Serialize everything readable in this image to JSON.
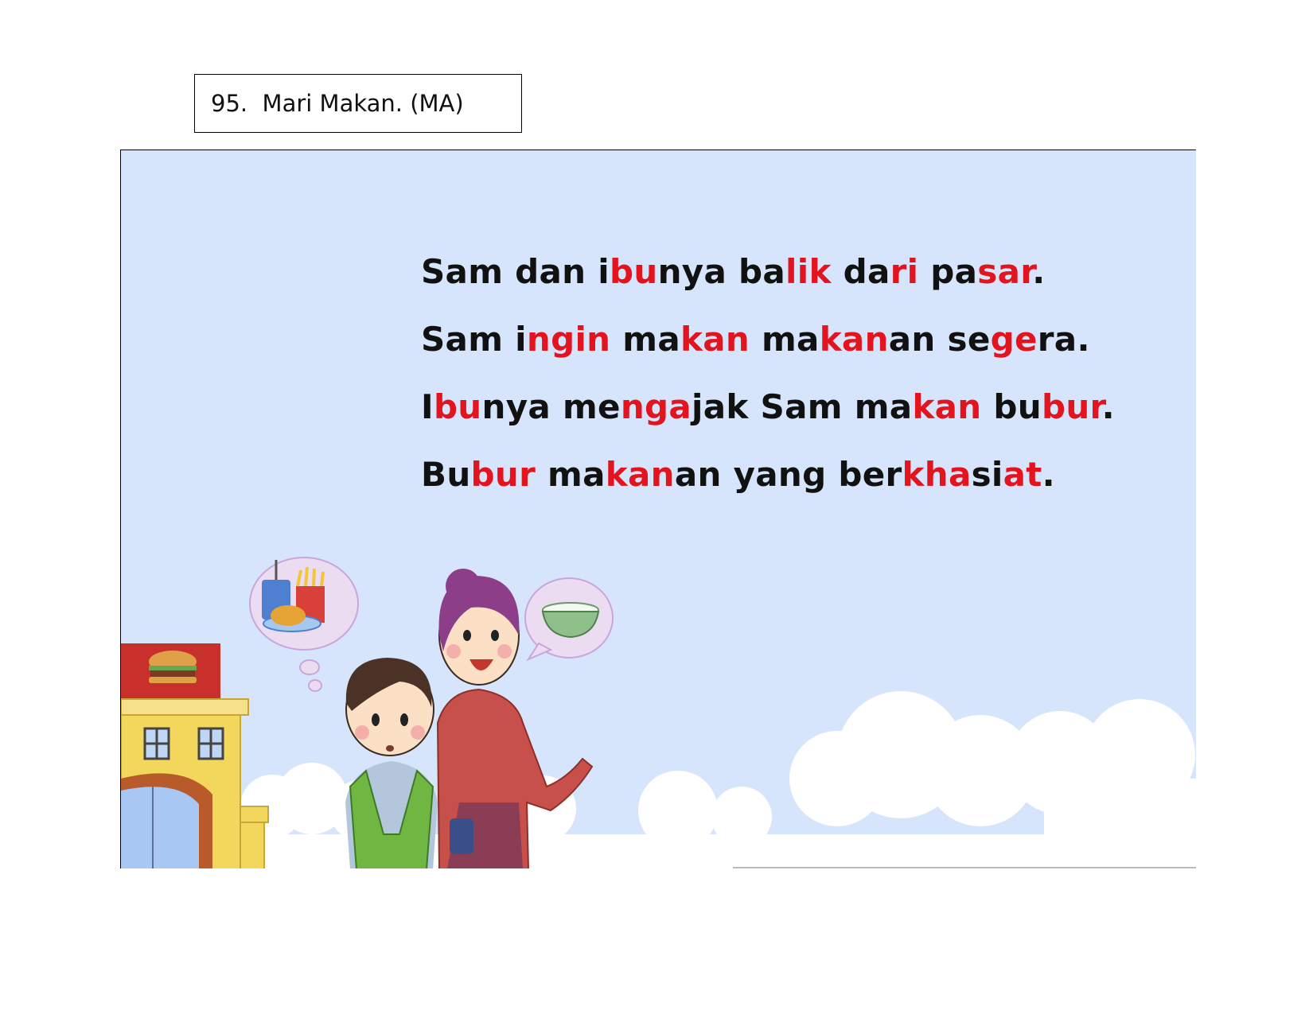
{
  "header": {
    "title": "95.  Mari Makan. (MA)"
  },
  "story": {
    "lines": [
      [
        {
          "t": "Sam dan i",
          "h": false
        },
        {
          "t": "bu",
          "h": true
        },
        {
          "t": "nya ba",
          "h": false
        },
        {
          "t": "lik",
          "h": true
        },
        {
          "t": " da",
          "h": false
        },
        {
          "t": "ri",
          "h": true
        },
        {
          "t": " pa",
          "h": false
        },
        {
          "t": "sar",
          "h": true
        },
        {
          "t": ".",
          "h": false
        }
      ],
      [
        {
          "t": "Sam i",
          "h": false
        },
        {
          "t": "ngin",
          "h": true
        },
        {
          "t": " ma",
          "h": false
        },
        {
          "t": "kan",
          "h": true
        },
        {
          "t": " ma",
          "h": false
        },
        {
          "t": "kan",
          "h": true
        },
        {
          "t": "an se",
          "h": false
        },
        {
          "t": "ge",
          "h": true
        },
        {
          "t": "ra.",
          "h": false
        }
      ],
      [
        {
          "t": "I",
          "h": false
        },
        {
          "t": "bu",
          "h": true
        },
        {
          "t": "nya me",
          "h": false
        },
        {
          "t": "nga",
          "h": true
        },
        {
          "t": "jak Sam ma",
          "h": false
        },
        {
          "t": "kan",
          "h": true
        },
        {
          "t": " bu",
          "h": false
        },
        {
          "t": "bur",
          "h": true
        },
        {
          "t": ".",
          "h": false
        }
      ],
      [
        {
          "t": "Bu",
          "h": false
        },
        {
          "t": "bur",
          "h": true
        },
        {
          "t": " ma",
          "h": false
        },
        {
          "t": "kan",
          "h": true
        },
        {
          "t": "an yang ber",
          "h": false
        },
        {
          "t": "kha",
          "h": true
        },
        {
          "t": "si",
          "h": false
        },
        {
          "t": "at",
          "h": true
        },
        {
          "t": ".",
          "h": false
        }
      ]
    ]
  },
  "colors": {
    "highlight": "#e3141e",
    "text": "#111111",
    "sky": "#d6e5fb"
  },
  "illustration": {
    "elements": [
      "fast-food-restaurant",
      "boy-sam",
      "mother",
      "thought-bubble-fast-food",
      "speech-bubble-porridge",
      "clouds"
    ]
  }
}
